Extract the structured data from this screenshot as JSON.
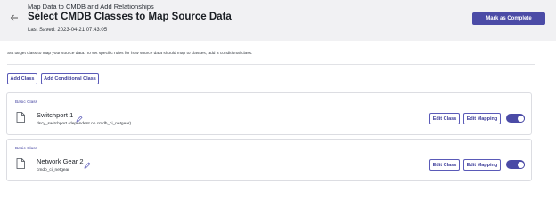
{
  "header": {
    "breadcrumb": "Map Data to CMDB and Add Relationships",
    "title": "Select CMDB Classes to Map Source Data",
    "last_saved": "Last Saved: 2023-04-21 07:43:05",
    "mark_complete_label": "Mark as Complete"
  },
  "instructions": "Set target class to map your source data. To set specific rules for how source data should map to classes, add a conditional class.",
  "actions": {
    "add_class_label": "Add Class",
    "add_conditional_label": "Add Conditional Class"
  },
  "cards": [
    {
      "kind": "Basic Class",
      "name": "Switchport 1",
      "subtext": "dscy_switchport (dependent on cmdb_ci_netgear)",
      "edit_class_label": "Edit Class",
      "edit_mapping_label": "Edit Mapping",
      "toggle_on": true
    },
    {
      "kind": "Basic Class",
      "name": "Network Gear 2",
      "subtext": "cmdb_ci_netgear",
      "edit_class_label": "Edit Class",
      "edit_mapping_label": "Edit Mapping",
      "toggle_on": true
    }
  ],
  "colors": {
    "accent": "#4b4ba6",
    "header_bg": "#f1f1f3"
  },
  "icons": {
    "back": "arrow-left-icon",
    "document": "document-icon",
    "edit": "pencil-icon"
  }
}
